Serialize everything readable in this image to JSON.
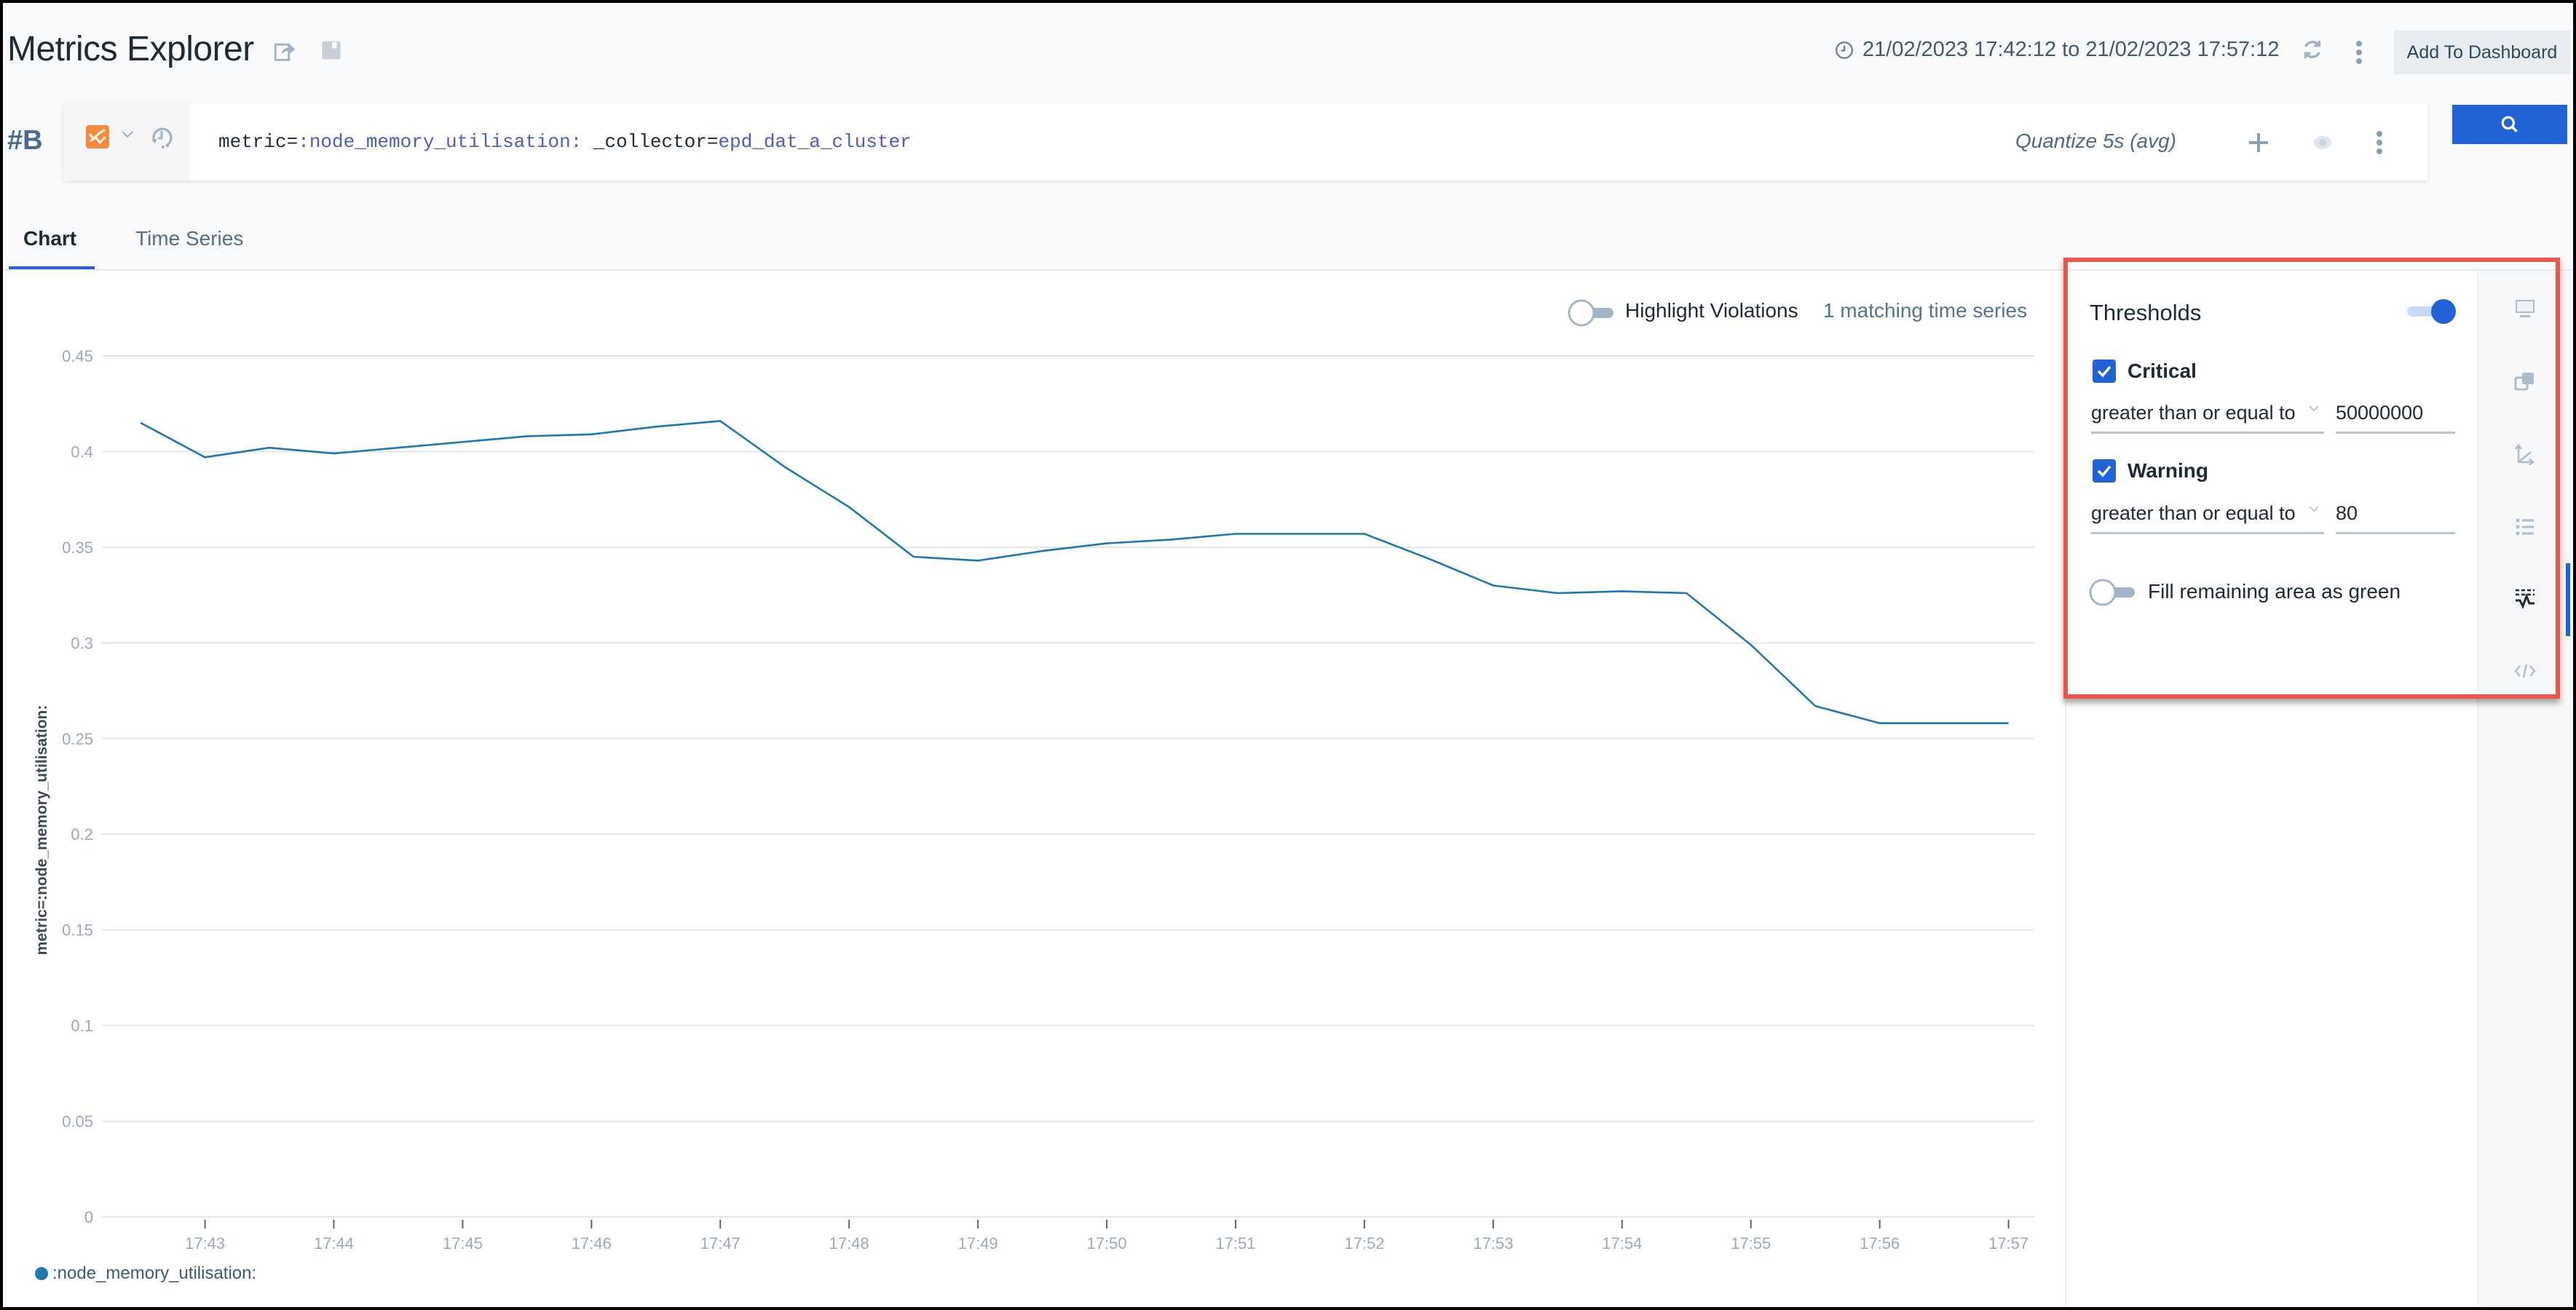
{
  "header": {
    "title": "Metrics Explorer",
    "time_range": "21/02/2023 17:42:12 to 21/02/2023 17:57:12",
    "add_to_dashboard": "Add To Dashboard",
    "icons": [
      "share-icon",
      "save-icon",
      "clock-icon",
      "refresh-icon",
      "more-vertical-icon"
    ]
  },
  "query": {
    "label": "#B",
    "prefix": "metric=",
    "metric": ":node_memory_utilisation:",
    "collector_key": " _collector=",
    "collector": "epd_dat_a_cluster",
    "quantize": "Quantize 5s (avg)",
    "icons": [
      "chart-type-icon",
      "chevron-down-icon",
      "history-icon",
      "plus-icon",
      "eye-icon",
      "more-vertical-icon",
      "search-icon"
    ]
  },
  "tabs": [
    {
      "label": "Chart",
      "active": true
    },
    {
      "label": "Time Series",
      "active": false
    }
  ],
  "chart_toolbar": {
    "highlight_violations": "Highlight Violations",
    "highlight_on": false,
    "matching": "1 matching time series"
  },
  "thresholds": {
    "title": "Thresholds",
    "enabled": true,
    "critical": {
      "label": "Critical",
      "checked": true,
      "operator": "greater than or equal to",
      "value": "50000000"
    },
    "warning": {
      "label": "Warning",
      "checked": true,
      "operator": "greater than or equal to",
      "value": "80"
    },
    "fill_green": {
      "label": "Fill remaining area as green",
      "on": false
    }
  },
  "side_icons": [
    "display-icon",
    "overlay-icon",
    "axes-icon",
    "legend-list-icon",
    "thresholds-icon",
    "code-icon"
  ],
  "colors": {
    "accent": "#1f63d6",
    "series": "#1f77b4",
    "highlight_box": "#f0554a",
    "chart_icon": "#f78b3c"
  },
  "chart_data": {
    "type": "line",
    "title": "",
    "xlabel": "",
    "ylabel": "metric=:node_memory_utilisation:",
    "ylim": [
      0,
      0.45
    ],
    "yticks": [
      "0",
      "0.05",
      "0.1",
      "0.15",
      "0.2",
      "0.25",
      "0.3",
      "0.35",
      "0.4",
      "0.45"
    ],
    "xticks": [
      "17:43",
      "17:44",
      "17:45",
      "17:46",
      "17:47",
      "17:48",
      "17:49",
      "17:50",
      "17:51",
      "17:52",
      "17:53",
      "17:54",
      "17:55",
      "17:56",
      "17:57"
    ],
    "x_range_minutes": [
      42.2,
      57.2
    ],
    "grid": true,
    "legend": "bottom-left",
    "series": [
      {
        "name": ":node_memory_utilisation:",
        "x_minutes": [
          42.5,
          43.0,
          43.5,
          44.0,
          44.5,
          45.0,
          45.5,
          46.0,
          46.5,
          47.0,
          47.5,
          48.0,
          48.5,
          49.0,
          49.5,
          50.0,
          50.5,
          51.0,
          51.5,
          52.0,
          52.5,
          53.0,
          53.5,
          54.0,
          54.5,
          55.0,
          55.5,
          56.0,
          56.5,
          57.0
        ],
        "values": [
          0.415,
          0.397,
          0.402,
          0.399,
          0.402,
          0.405,
          0.408,
          0.409,
          0.413,
          0.416,
          0.392,
          0.371,
          0.345,
          0.343,
          0.348,
          0.352,
          0.354,
          0.357,
          0.357,
          0.357,
          0.344,
          0.33,
          0.326,
          0.327,
          0.326,
          0.299,
          0.267,
          0.258,
          0.258,
          0.258
        ]
      }
    ]
  }
}
